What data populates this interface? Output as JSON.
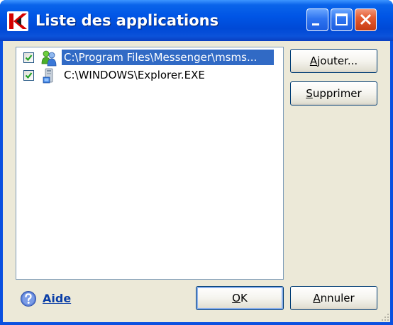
{
  "window": {
    "title": "Liste des applications",
    "app_icon": "kaspersky-k-icon",
    "controls": [
      "minimize-icon",
      "maximize-icon",
      "close-icon"
    ]
  },
  "applications": [
    {
      "path": "C:\\Program Files\\Messenger\\msms...",
      "checked": true,
      "selected": true,
      "icon": "messenger-users-icon"
    },
    {
      "path": "C:\\WINDOWS\\Explorer.EXE",
      "checked": true,
      "selected": false,
      "icon": "explorer-computer-icon"
    }
  ],
  "buttons": {
    "add": {
      "accel": "A",
      "rest": "jouter..."
    },
    "remove": {
      "accel": "S",
      "rest": "upprimer"
    },
    "ok": {
      "accel": "O",
      "rest": "K"
    },
    "cancel": {
      "accel": "A",
      "rest": "nnuler"
    }
  },
  "help": {
    "label": "Aide",
    "icon": "help-icon"
  },
  "colors": {
    "titlebar": "#0055e5",
    "selection": "#316ac5",
    "dialog_bg": "#ece9d8",
    "help_link": "#0a3ea6"
  }
}
